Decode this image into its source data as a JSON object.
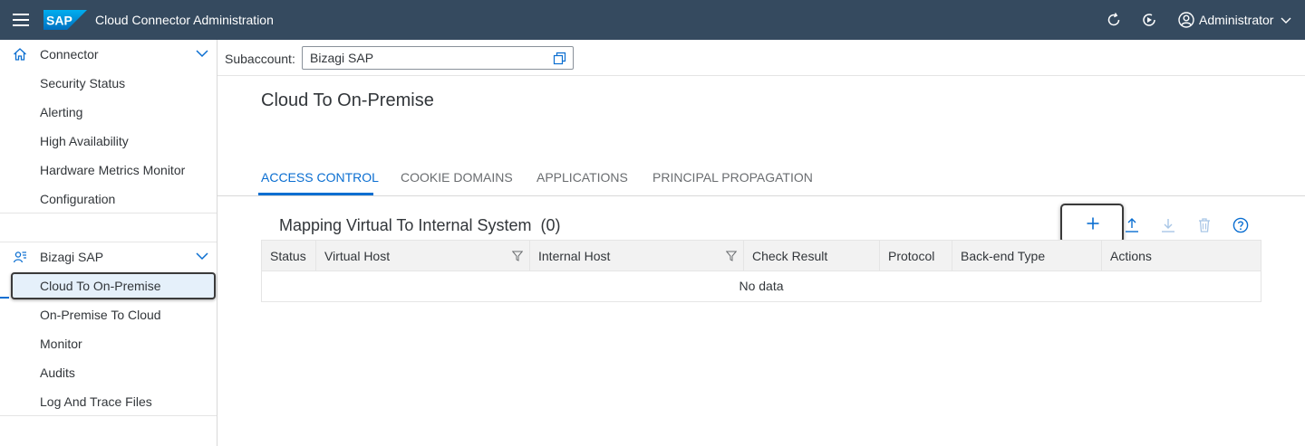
{
  "shell": {
    "title": "Cloud Connector Administration",
    "logo_text": "SAP",
    "user_name": "Administrator",
    "colors": {
      "shell_bg": "#354a5f",
      "accent": "#0a6ed1",
      "logo": "#0a6ed1"
    }
  },
  "sidebar": {
    "groups": [
      {
        "label": "Connector",
        "icon": "home-icon",
        "items": [
          {
            "label": "Security Status"
          },
          {
            "label": "Alerting"
          },
          {
            "label": "High Availability"
          },
          {
            "label": "Hardware Metrics Monitor"
          },
          {
            "label": "Configuration"
          }
        ]
      },
      {
        "label": "Bizagi SAP",
        "icon": "subaccount-icon",
        "items": [
          {
            "label": "Cloud To On-Premise",
            "selected": true
          },
          {
            "label": "On-Premise To Cloud"
          },
          {
            "label": "Monitor"
          },
          {
            "label": "Audits"
          },
          {
            "label": "Log And Trace Files"
          }
        ]
      }
    ]
  },
  "subaccount": {
    "label": "Subaccount:",
    "value": "Bizagi SAP"
  },
  "page": {
    "title": "Cloud To On-Premise"
  },
  "tabs": [
    {
      "label": "ACCESS CONTROL",
      "active": true
    },
    {
      "label": "COOKIE DOMAINS",
      "active": false
    },
    {
      "label": "APPLICATIONS",
      "active": false
    },
    {
      "label": "PRINCIPAL PROPAGATION",
      "active": false
    }
  ],
  "table": {
    "title": "Mapping Virtual To Internal System",
    "count": "(0)",
    "columns": [
      "Status",
      "Virtual Host",
      "Internal Host",
      "Check Result",
      "Protocol",
      "Back-end Type",
      "Actions"
    ],
    "empty_text": "No data",
    "toolbar": [
      "add-icon",
      "upload-icon",
      "download-icon",
      "delete-icon",
      "help-icon"
    ]
  }
}
